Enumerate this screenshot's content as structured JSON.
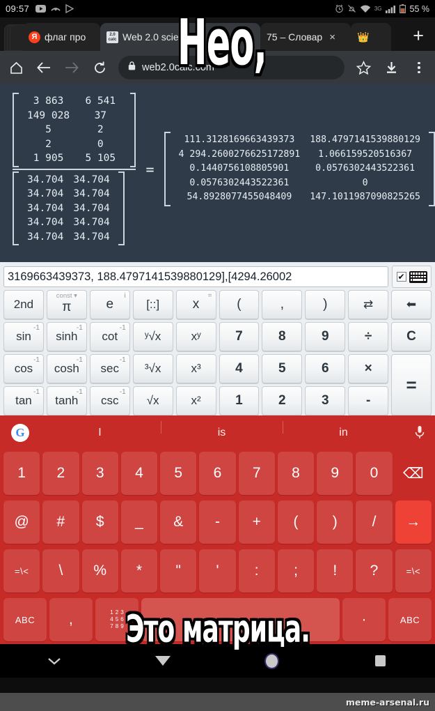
{
  "status_bar": {
    "time": "09:57",
    "left_icons": [
      "youtube-icon",
      "missed-call-icon",
      "play-store-icon"
    ],
    "right_icons": [
      "alarm-icon",
      "notifications-muted-icon",
      "wifi-icon",
      "mobile-signal-icon"
    ],
    "network_type": "3G",
    "battery": "55 %"
  },
  "browser": {
    "tabs": [
      {
        "label": "флаг про",
        "favicon": "yandex-icon"
      },
      {
        "label": "Web 2.0 scienti",
        "favicon": "web20calc-icon"
      },
      {
        "label": "75 – Словар",
        "favicon": "dictionary-icon",
        "close": "×"
      },
      {
        "label": "",
        "favicon": "crown-emoji-icon"
      }
    ],
    "new_tab_label": "+",
    "toolbar": {
      "home": "home-icon",
      "back": "back-icon",
      "forward": "forward-icon",
      "reload": "reload-icon",
      "lock": "lock-icon",
      "url": "web2.0calc.com",
      "bookmark": "star-icon",
      "download": "download-icon",
      "menu": "overflow-menu-icon"
    }
  },
  "calculator": {
    "equation": {
      "numerator": [
        [
          "3 863",
          "6 541"
        ],
        [
          "149 028",
          "37"
        ],
        [
          "5",
          "2"
        ],
        [
          "2",
          "0"
        ],
        [
          "1 905",
          "5 105"
        ]
      ],
      "denominator": [
        [
          "34.704",
          "34.704"
        ],
        [
          "34.704",
          "34.704"
        ],
        [
          "34.704",
          "34.704"
        ],
        [
          "34.704",
          "34.704"
        ],
        [
          "34.704",
          "34.704"
        ]
      ],
      "equals": "=",
      "result": [
        [
          "111.3128169663439373",
          "188.4797141539880129"
        ],
        [
          "4 294.2600276625172891",
          "1.066159520516367"
        ],
        [
          "0.1440756108805901",
          "0.0576302443522361"
        ],
        [
          "0.0576302443522361",
          "0"
        ],
        [
          "54.8928077455048409",
          "147.1011987090825265"
        ]
      ]
    },
    "input_value": "3169663439373, 188.4797141539880129],[4294.26002",
    "checkbox_checked": "✔",
    "keyboard_toggle": "keyboard-icon",
    "keys": [
      {
        "label": "2nd"
      },
      {
        "label": "π",
        "top": "const ▾"
      },
      {
        "label": "e",
        "sup": "i"
      },
      {
        "label": "[::]"
      },
      {
        "label": "x",
        "sup": "="
      },
      {
        "label": "("
      },
      {
        "label": ","
      },
      {
        "label": ")"
      },
      {
        "label": "⇄"
      },
      {
        "label": "⬅"
      },
      {
        "label": "sin",
        "sup": "-1"
      },
      {
        "label": "sinh",
        "sup": "-1"
      },
      {
        "label": "cot",
        "sup": "-1"
      },
      {
        "label": "ʸ√x"
      },
      {
        "label": "xʸ"
      },
      {
        "label": "7"
      },
      {
        "label": "8"
      },
      {
        "label": "9"
      },
      {
        "label": "÷"
      },
      {
        "label": "C"
      },
      {
        "label": "cos",
        "sup": "-1"
      },
      {
        "label": "cosh",
        "sup": "-1"
      },
      {
        "label": "sec",
        "sup": "-1"
      },
      {
        "label": "³√x"
      },
      {
        "label": "x³"
      },
      {
        "label": "4"
      },
      {
        "label": "5"
      },
      {
        "label": "6"
      },
      {
        "label": "×"
      },
      {
        "label": "="
      },
      {
        "label": "tan",
        "sup": "-1"
      },
      {
        "label": "tanh",
        "sup": "-1"
      },
      {
        "label": "csc",
        "sup": "-1"
      },
      {
        "label": "√x"
      },
      {
        "label": "x²"
      },
      {
        "label": "1"
      },
      {
        "label": "2"
      },
      {
        "label": "3"
      },
      {
        "label": "-"
      }
    ]
  },
  "keyboard": {
    "suggestions": [
      "I",
      "is",
      "in"
    ],
    "google_logo": "G",
    "mic": "mic-icon",
    "rows": [
      [
        "1",
        "2",
        "3",
        "4",
        "5",
        "6",
        "7",
        "8",
        "9",
        "0",
        "⌫"
      ],
      [
        "@",
        "#",
        "$",
        "_",
        "&",
        "-",
        "+",
        "(",
        ")",
        "/",
        "→"
      ],
      [
        "=\\<",
        "\\",
        "%",
        "*",
        "\"",
        "'",
        ":",
        ";",
        "!",
        "?",
        "=\\<"
      ],
      [
        "ABC",
        ",",
        "123",
        "",
        " ",
        ".",
        "ABC"
      ]
    ],
    "bottom_row": {
      "abc_left": "ABC",
      "comma": ",",
      "grid": "123",
      "space": "",
      "period": "·",
      "abc_right": "ABC"
    }
  },
  "nav_bar": {
    "hide_keyboard": "chevron-down-icon",
    "back": "back-triangle-icon",
    "home": "home-circle-icon",
    "recents": "recents-square-icon"
  },
  "meme": {
    "top_text": "Нео,",
    "bottom_text": "Это матрица.",
    "watermark": "meme-arsenal.ru"
  },
  "colors": {
    "keyboard_red": "#c62b27",
    "key_red": "#cf4542",
    "enter_red": "#ef4236",
    "page_bg": "#2f3b49",
    "toolbar_bg": "#35383c"
  }
}
